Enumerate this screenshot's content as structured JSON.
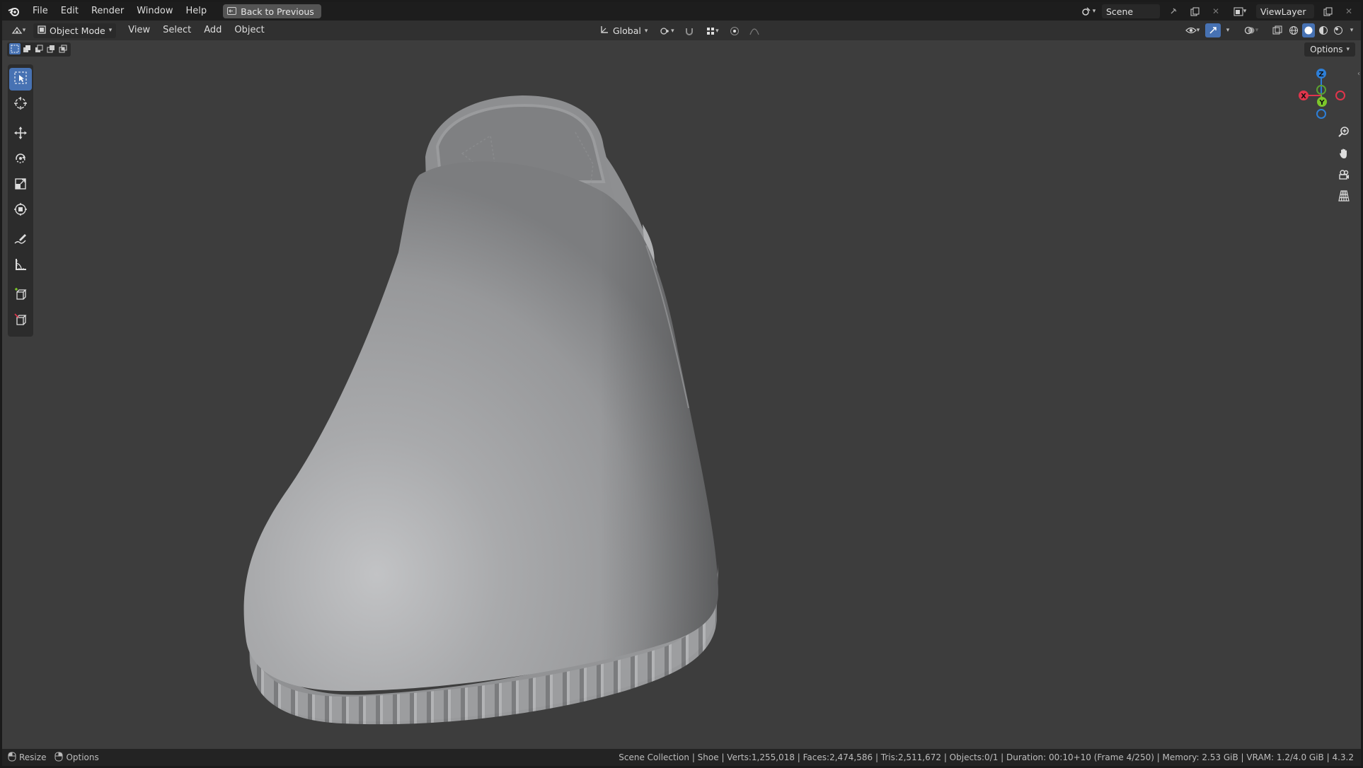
{
  "menu": [
    "File",
    "Edit",
    "Render",
    "Window",
    "Help"
  ],
  "back_button": "Back to Previous",
  "scene_name": "Scene",
  "view_layer": "ViewLayer",
  "mode": "Object Mode",
  "header_menus": [
    "View",
    "Select",
    "Add",
    "Object"
  ],
  "transform_orientation": "Global",
  "options_label": "Options",
  "gizmo_axes": {
    "z": "Z",
    "y": "Y",
    "x": "X"
  },
  "status": {
    "left": {
      "resize": "Resize",
      "options": "Options"
    },
    "right": "Scene Collection | Shoe | Verts:1,255,018 | Faces:2,474,586 | Tris:2,511,672 | Objects:0/1 | Duration: 00:10+10 (Frame 4/250) | Memory: 2.53 GiB | VRAM: 1.2/4.0 GiB | 4.3.2"
  },
  "colors": {
    "viewport_bg": "#3d3d3d",
    "accent": "#4772b3",
    "axis_x": "#e0354c",
    "axis_y": "#7cc62a",
    "axis_z": "#2d7fd8"
  }
}
